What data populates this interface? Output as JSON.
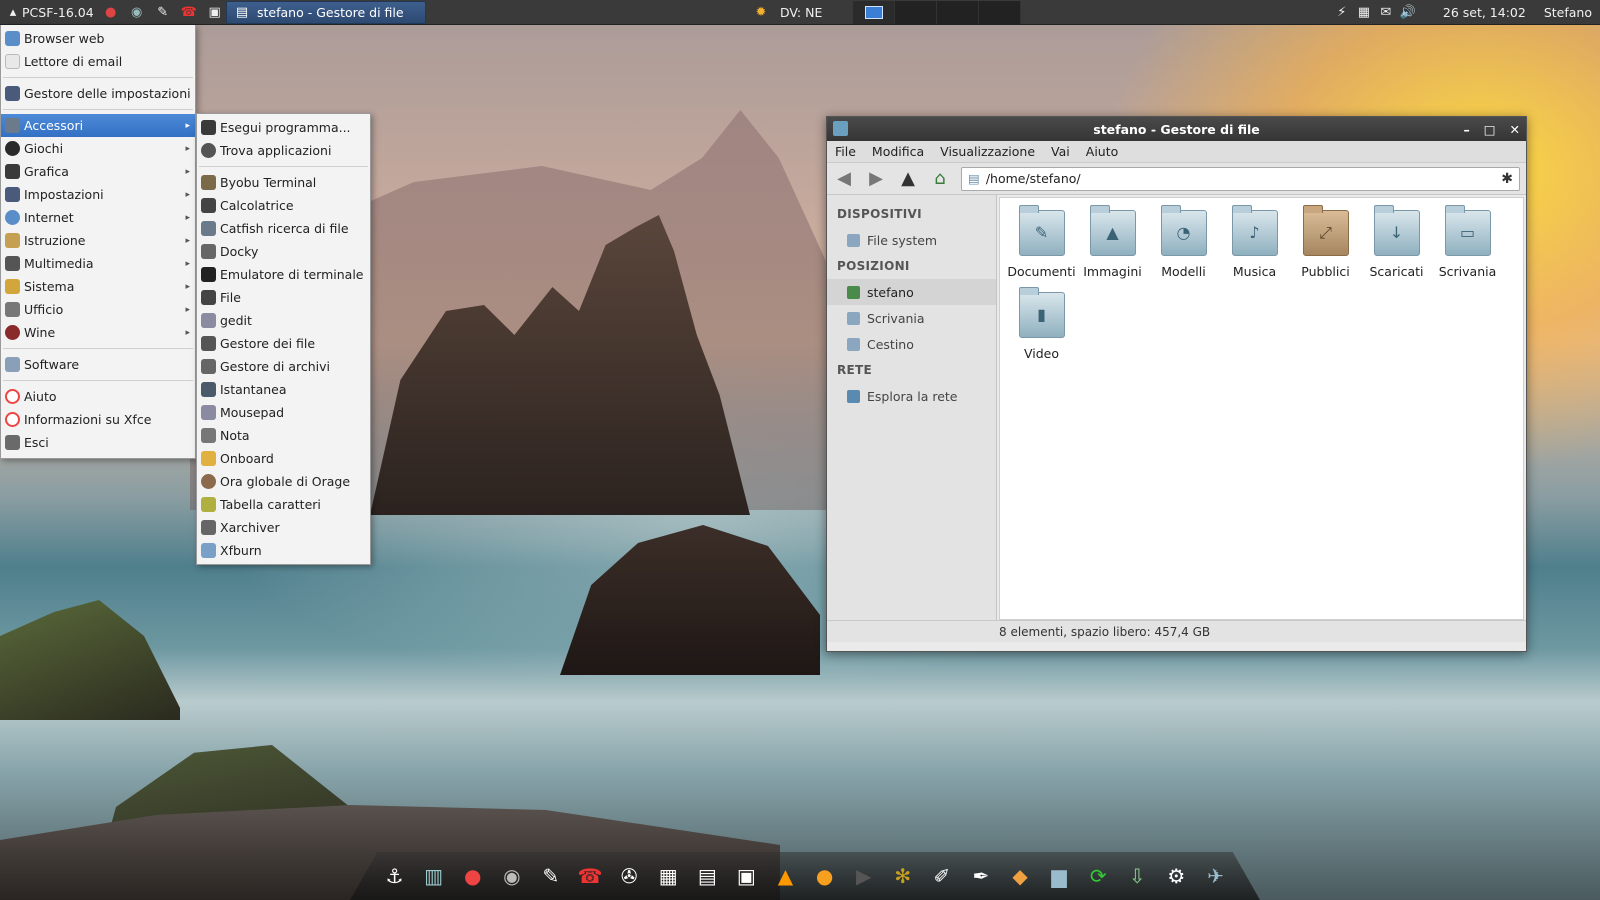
{
  "panel": {
    "app_label": "PCSF-16.04",
    "task_title": "stefano - Gestore di file",
    "weather": "DV: NE",
    "datetime": "26 set, 14:02",
    "user": "Stefano"
  },
  "menu": {
    "top_items": [
      "Browser web",
      "Lettore di email"
    ],
    "settings_item": "Gestore delle impostazioni",
    "categories": [
      "Accessori",
      "Giochi",
      "Grafica",
      "Impostazioni",
      "Internet",
      "Istruzione",
      "Multimedia",
      "Sistema",
      "Ufficio",
      "Wine"
    ],
    "software": "Software",
    "bottom_items": [
      "Aiuto",
      "Informazioni su Xfce",
      "Esci"
    ]
  },
  "submenu": {
    "top_items": [
      "Esegui programma...",
      "Trova applicazioni"
    ],
    "apps": [
      "Byobu Terminal",
      "Calcolatrice",
      "Catfish ricerca di file",
      "Docky",
      "Emulatore di terminale",
      "File",
      "gedit",
      "Gestore dei file",
      "Gestore di archivi",
      "Istantanea",
      "Mousepad",
      "Nota",
      "Onboard",
      "Ora globale di Orage",
      "Tabella caratteri",
      "Xarchiver",
      "Xfburn"
    ]
  },
  "file_manager": {
    "title": "stefano - Gestore di file",
    "menubar": [
      "File",
      "Modifica",
      "Visualizzazione",
      "Vai",
      "Aiuto"
    ],
    "path": "/home/stefano/",
    "sidebar": {
      "devices_header": "DISPOSITIVI",
      "devices": [
        "File system"
      ],
      "places_header": "POSIZIONI",
      "places": [
        "stefano",
        "Scrivania",
        "Cestino"
      ],
      "network_header": "RETE",
      "network": [
        "Esplora la rete"
      ]
    },
    "files": [
      "Documenti",
      "Immagini",
      "Modelli",
      "Musica",
      "Pubblici",
      "Scaricati",
      "Scrivania",
      "Video"
    ],
    "status": "8 elementi, spazio libero: 457,4 GB"
  },
  "colors": {
    "highlight": "#3d7fd0",
    "panel_bg": "#3a3a3a",
    "titlebar": "#3f3f3f"
  }
}
